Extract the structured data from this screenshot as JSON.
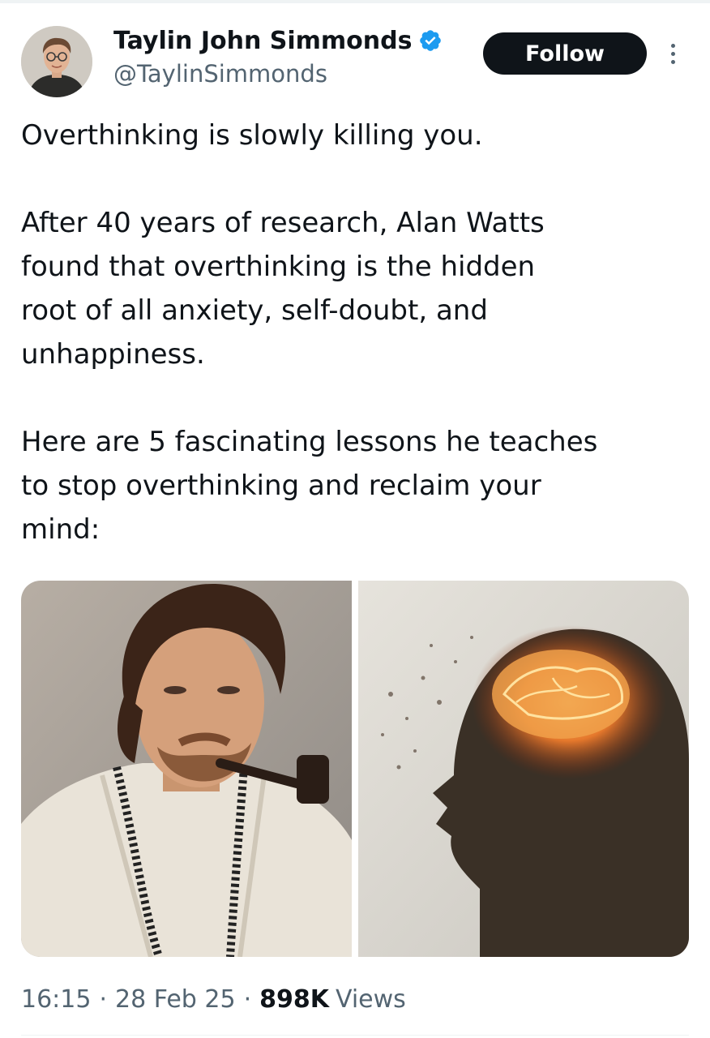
{
  "author": {
    "display_name": "Taylin John Simmonds",
    "handle": "@TaylinSimmonds",
    "verified": true,
    "verified_color": "#1d9bf0",
    "avatar_icon": "profile-photo"
  },
  "actions": {
    "follow_label": "Follow",
    "more_icon": "more-vertical-icon"
  },
  "tweet": {
    "paragraphs": [
      "Overthinking is slowly killing you.",
      "After 40 years of research, Alan Watts\nfound that overthinking is the hidden\nroot of all anxiety, self-doubt, and\nunhappiness.",
      "Here are 5 fascinating lessons he teaches\nto stop overthinking and reclaim your\nmind:"
    ]
  },
  "media": [
    {
      "depicts": "portrait-photo"
    },
    {
      "depicts": "glowing-brain-silhouette-image"
    }
  ],
  "meta": {
    "time": "16:15",
    "date": "28 Feb 25",
    "separator": "·",
    "views_count": "898K",
    "views_label": "Views"
  },
  "colors": {
    "text_primary": "#0f1419",
    "text_secondary": "#536471",
    "follow_button_bg": "#0f1419",
    "follow_button_text": "#ffffff"
  }
}
